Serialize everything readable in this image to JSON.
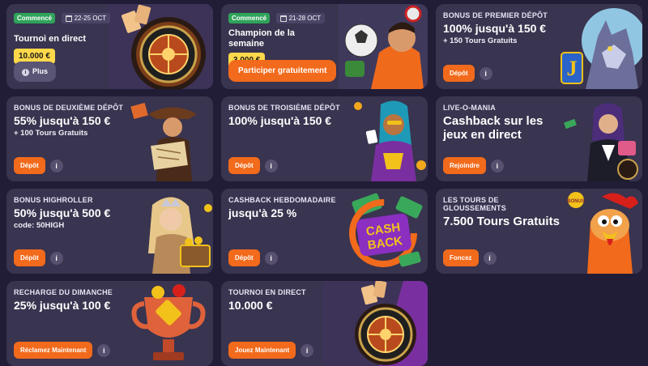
{
  "cards": [
    {
      "tag": "Commencé",
      "date": "22-25 OCT",
      "title": "Tournoi en direct",
      "amount": "10.000 €",
      "button": "Plus"
    },
    {
      "tag": "Commencé",
      "date": "21-28 OCT",
      "title": "Champion de la semaine",
      "amount": "3.000 €",
      "button": "Participer gratuitement"
    },
    {
      "label": "BONUS DE PREMIER DÉPÔT",
      "title": "100% jusqu'à 150 €",
      "sub": "+ 150 Tours Gratuits",
      "button": "Dépôt"
    },
    {
      "label": "BONUS DE DEUXIÈME DÉPÔT",
      "title": "55% jusqu'à 150 €",
      "sub": "+ 100 Tours Gratuits",
      "button": "Dépôt"
    },
    {
      "label": "BONUS DE TROISIÈME DÉPÔT",
      "title": "100% jusqu'à 150 €",
      "button": "Dépôt"
    },
    {
      "label": "LIVE-O-MANIA",
      "title": "Cashback sur les jeux en direct",
      "button": "Rejoindre"
    },
    {
      "label": "BONUS HIGHROLLER",
      "title": "50% jusqu'à 500 €",
      "sub": "code: 50HIGH",
      "button": "Dépôt"
    },
    {
      "label": "CASHBACK HEBDOMADAIRE",
      "title": "jusqu'à 25 %",
      "button": "Dépôt"
    },
    {
      "label": "LES TOURS DE GLOUSSEMENTS",
      "title": "7.500 Tours Gratuits",
      "button": "Foncez"
    },
    {
      "label": "RECHARGE DU DIMANCHE",
      "title": "25% jusqu'à 100 €",
      "button": "Réclamez Maintenant"
    },
    {
      "label": "TOURNOI EN DIRECT",
      "title": "10.000 €",
      "button": "Jouez Maintenant"
    }
  ],
  "art_text": {
    "cash": "CASH",
    "back": "BACK",
    "jackpot": "J",
    "bonus": "BONUS"
  },
  "icons": {
    "info": "info-icon",
    "calendar": "calendar-icon"
  },
  "colors": {
    "accent": "#f26a1b",
    "card": "#39344f",
    "background": "#211d36",
    "amount": "#ffd84a",
    "tag": "#2fa35a"
  }
}
